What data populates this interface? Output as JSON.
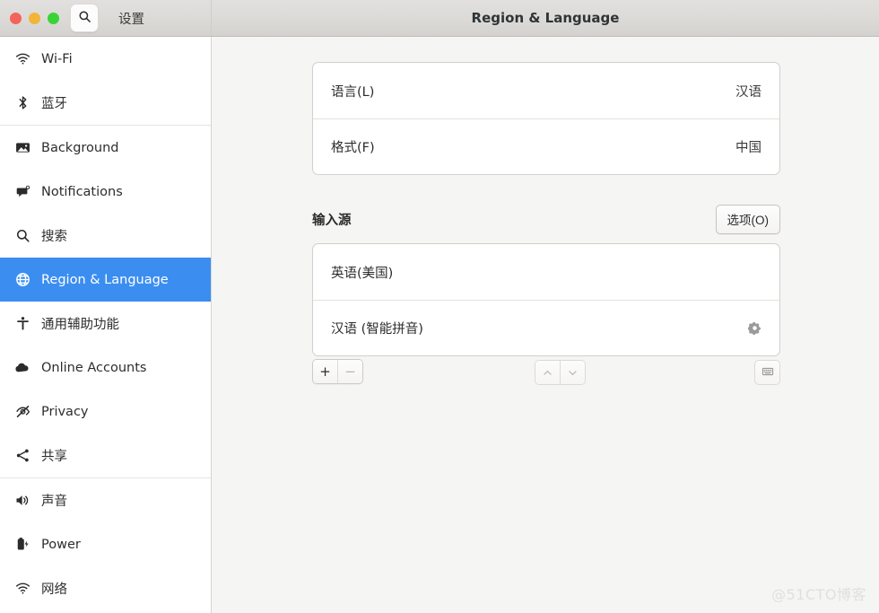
{
  "window": {
    "app_name": "设置",
    "title": "Region & Language",
    "controls": {
      "close": "close-dot",
      "minimize": "minimize-dot",
      "maximize": "maximize-dot"
    },
    "search_icon": "search-icon"
  },
  "colors": {
    "selection_blue": "#3b8ef0",
    "titlebar": "#dcdad7",
    "sidebar_bg": "#ffffff",
    "content_bg": "#f5f5f4",
    "card_bg": "#ffffff",
    "dot_close": "#f4645a",
    "dot_min": "#f2b538",
    "dot_max": "#3ad337"
  },
  "sidebar": {
    "groups": [
      {
        "items": [
          {
            "label": "Wi-Fi",
            "icon": "wifi-icon",
            "selected": false
          },
          {
            "label": "蓝牙",
            "icon": "bluetooth-icon",
            "selected": false
          }
        ]
      },
      {
        "items": [
          {
            "label": "Background",
            "icon": "image-icon",
            "selected": false
          },
          {
            "label": "Notifications",
            "icon": "notification-bubble-icon",
            "selected": false
          },
          {
            "label": "搜索",
            "icon": "search-icon",
            "selected": false
          },
          {
            "label": "Region & Language",
            "icon": "globe-icon",
            "selected": true
          },
          {
            "label": "通用辅助功能",
            "icon": "accessibility-icon",
            "selected": false
          },
          {
            "label": "Online Accounts",
            "icon": "cloud-icon",
            "selected": false
          },
          {
            "label": "Privacy",
            "icon": "eye-off-icon",
            "selected": false
          },
          {
            "label": "共享",
            "icon": "share-icon",
            "selected": false
          }
        ]
      },
      {
        "items": [
          {
            "label": "声音",
            "icon": "speaker-icon",
            "selected": false
          },
          {
            "label": "Power",
            "icon": "battery-icon",
            "selected": false
          },
          {
            "label": "网络",
            "icon": "wifi-icon",
            "selected": false
          }
        ]
      }
    ]
  },
  "main": {
    "language_card": {
      "rows": [
        {
          "label": "语言(L)",
          "value": "汉语"
        },
        {
          "label": "格式(F)",
          "value": "中国"
        }
      ]
    },
    "input_sources": {
      "title": "输入源",
      "options_button": "选项(O)",
      "items": [
        {
          "label": "英语(美国)",
          "has_gear": false
        },
        {
          "label": "汉语 (智能拼音)",
          "has_gear": true,
          "gear_icon": "gear-icon"
        }
      ]
    },
    "toolbar": {
      "add": "+",
      "remove": "−",
      "move_up": "⌃",
      "move_down": "⌄",
      "keyboard_icon": "keyboard-icon"
    }
  },
  "watermark": "@51CTO博客"
}
